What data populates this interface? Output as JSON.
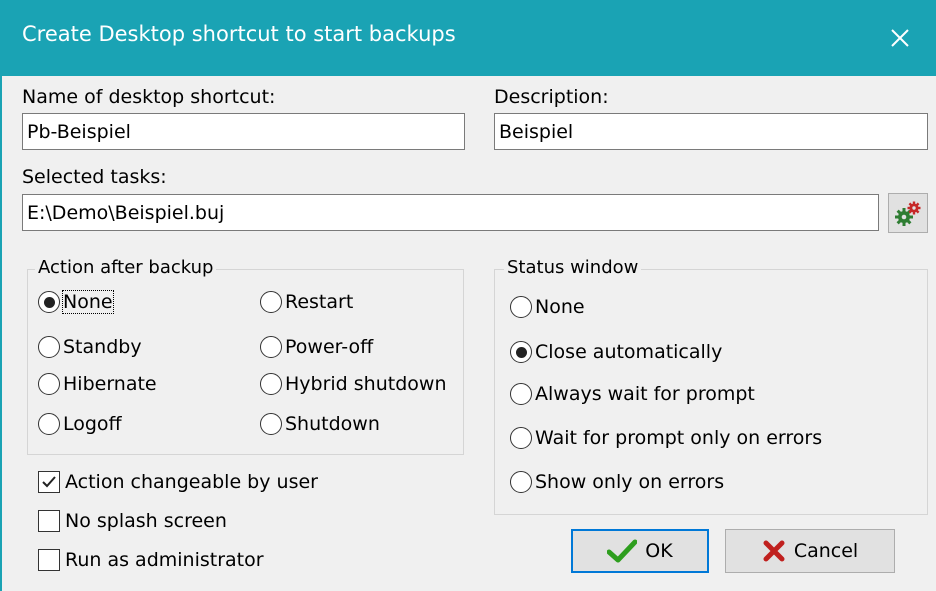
{
  "window": {
    "title": "Create Desktop shortcut to start backups",
    "close_icon": "close-icon"
  },
  "fields": {
    "name_label": "Name of desktop shortcut:",
    "name_value": "Pb-Beispiel",
    "description_label": "Description:",
    "description_value": "Beispiel",
    "tasks_label": "Selected tasks:",
    "tasks_value": "E:\\Demo\\Beispiel.buj",
    "tasks_button_icon": "gears-icon"
  },
  "action_group": {
    "title": "Action after backup",
    "options": [
      "None",
      "Standby",
      "Hibernate",
      "Logoff",
      "Restart",
      "Power-off",
      "Hybrid shutdown",
      "Shutdown"
    ],
    "selected": "None"
  },
  "status_group": {
    "title": "Status window",
    "options": [
      "None",
      "Close automatically",
      "Always wait for prompt",
      "Wait for prompt only on errors",
      "Show only on errors"
    ],
    "selected": "Close automatically"
  },
  "checkboxes": [
    {
      "label": "Action changeable by user",
      "checked": true
    },
    {
      "label": "No splash screen",
      "checked": false
    },
    {
      "label": "Run as administrator",
      "checked": false
    }
  ],
  "buttons": {
    "ok_label": "OK",
    "cancel_label": "Cancel"
  },
  "colors": {
    "titlebar": "#1aa3b4",
    "ok_check": "#2e9e1e",
    "cancel_x": "#c0201e",
    "focus_border": "#0078d7"
  }
}
